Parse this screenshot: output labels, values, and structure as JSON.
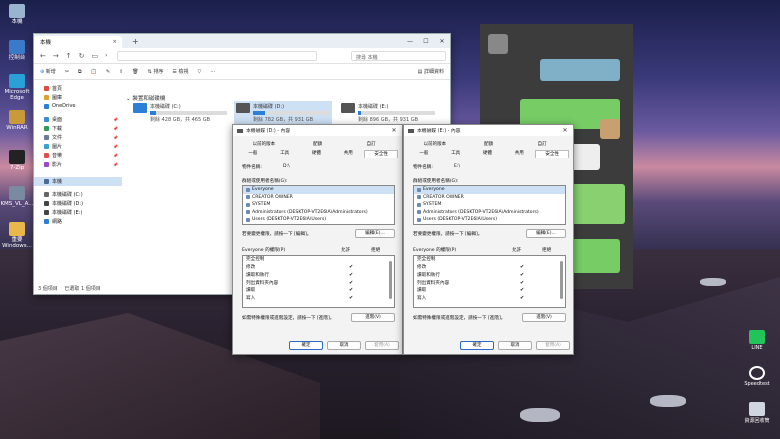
{
  "desktop_icons": [
    {
      "label": "本機",
      "icon": "computer-icon"
    },
    {
      "label": "控制台",
      "icon": "control-panel-icon"
    },
    {
      "label": "Microsoft Edge",
      "icon": "edge-icon"
    },
    {
      "label": "WinRAR",
      "icon": "winrar-icon"
    },
    {
      "label": "7-Zip",
      "icon": "7zip-icon"
    },
    {
      "label": "KMS_VL_A...",
      "icon": "kms-icon"
    },
    {
      "label": "重要Windows...",
      "icon": "folder-icon"
    }
  ],
  "tray_icons": [
    {
      "label": "LINE"
    },
    {
      "label": "Speedtest"
    },
    {
      "label": "資源回收筒"
    }
  ],
  "explorer": {
    "tab_title": "本機",
    "search_placeholder": "搜尋 本機",
    "toolbar": {
      "new": "新增",
      "sort": "排序",
      "view": "檢視",
      "details": "詳細資料"
    },
    "section_title": "裝置和磁碟機",
    "sidebar": [
      {
        "label": "首頁",
        "color": "#e04a3a"
      },
      {
        "label": "圖庫",
        "color": "#e0a030"
      },
      {
        "label": "OneDrive",
        "color": "#2c7fd6"
      },
      {
        "label": "桌面",
        "color": "#3a8ad8"
      },
      {
        "label": "下載",
        "color": "#2f9a5a"
      },
      {
        "label": "文件",
        "color": "#6a7a9a"
      },
      {
        "label": "圖片",
        "color": "#3aa0d0"
      },
      {
        "label": "音樂",
        "color": "#e0504a"
      },
      {
        "label": "影片",
        "color": "#9a4ac8"
      },
      {
        "label": "本機",
        "color": "#4a6a9a"
      },
      {
        "label": "本機磁碟 (C:)",
        "color": "#666666"
      },
      {
        "label": "本機磁碟 (D:)",
        "color": "#444444"
      },
      {
        "label": "本機磁碟 (E:)",
        "color": "#444444"
      },
      {
        "label": "網路",
        "color": "#2c7fd6"
      }
    ],
    "drives": [
      {
        "name": "本機磁碟 (C:)",
        "free": "剩餘 428 GB，共 465 GB",
        "used_fraction": 0.08
      },
      {
        "name": "本機磁碟 (D:)",
        "free": "剩餘 782 GB，共 931 GB",
        "used_fraction": 0.16
      },
      {
        "name": "本機磁碟 (E:)",
        "free": "剩餘 896 GB，共 931 GB",
        "used_fraction": 0.04
      }
    ],
    "status": "3 個項目　 已選取 1 個項目"
  },
  "dialogs": [
    {
      "title": "本機磁碟 (D:) - 內容",
      "drive_value": "D:\\"
    },
    {
      "title": "本機磁碟 (E:) - 內容",
      "drive_value": "E:\\"
    }
  ],
  "dlg_common": {
    "tabs_row1": [
      "以前的版本",
      "配額",
      "自訂"
    ],
    "tabs_row2": [
      "一般",
      "工具",
      "硬體",
      "共用",
      "安全性"
    ],
    "object_name_label": "物件名稱:",
    "groups_label": "群組或使用者名稱(G):",
    "groups": [
      "Everyone",
      "CREATOR OWNER",
      "SYSTEM",
      "Administrators (DESKTOP-VT2E6IA\\Administrators)",
      "Users (DESKTOP-VT2E6IA\\Users)"
    ],
    "change_hint": "若要變更權限，請按一下 [編輯]。",
    "edit_button": "編輯(E)...",
    "perm_label": "Everyone 的權限(P)",
    "allow": "允許",
    "deny": "拒絕",
    "perms": [
      "完全控制",
      "修改",
      "讀取和執行",
      "列出資料夾內容",
      "讀取",
      "寫入"
    ],
    "adv_hint": "如需特殊權限或進階設定，請按一下 [進階]。",
    "advanced_button": "進階(V)",
    "ok": "確定",
    "cancel": "取消",
    "apply": "套用(A)"
  }
}
